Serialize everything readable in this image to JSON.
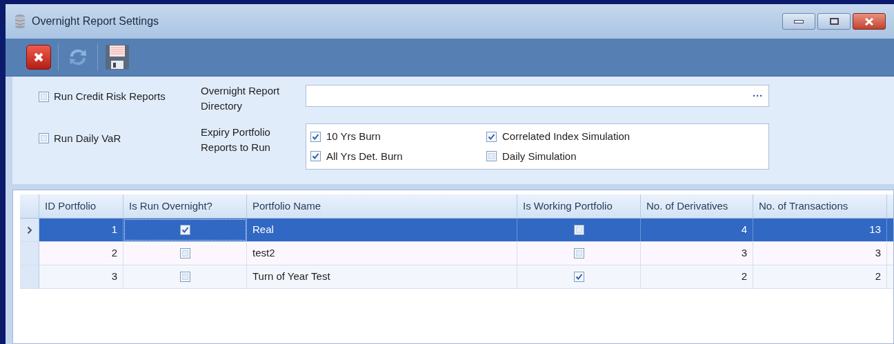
{
  "window": {
    "title": "Overnight Report Settings"
  },
  "options": [
    {
      "label": "Run Credit Risk Reports",
      "checked": false
    },
    {
      "label": "Run Daily VaR",
      "checked": false
    }
  ],
  "directory": {
    "label": "Overnight Report Directory",
    "browse": "···"
  },
  "expiry": {
    "label": "Expiry Portfolio Reports to Run",
    "items": [
      {
        "label": "10 Yrs Burn",
        "checked": true
      },
      {
        "label": "Correlated Index Simulation",
        "checked": true
      },
      {
        "label": "All Yrs Det. Burn",
        "checked": true
      },
      {
        "label": "Daily Simulation",
        "checked": false
      }
    ]
  },
  "table": {
    "columns": [
      "ID Portfolio",
      "Is Run Overnight?",
      "Portfolio Name",
      "Is Working Portfolio",
      "No. of Derivatives",
      "No. of Transactions"
    ],
    "rows": [
      {
        "selected": true,
        "id": "1",
        "run_overnight": true,
        "run_focused": true,
        "name": "Real",
        "working": false,
        "derivatives": "4",
        "transactions": "13"
      },
      {
        "selected": false,
        "id": "2",
        "run_overnight": false,
        "run_focused": false,
        "name": "test2",
        "working": false,
        "derivatives": "3",
        "transactions": "3"
      },
      {
        "selected": false,
        "id": "3",
        "run_overnight": false,
        "run_focused": false,
        "name": "Turn of Year Test",
        "working": true,
        "derivatives": "2",
        "transactions": "2"
      }
    ]
  }
}
